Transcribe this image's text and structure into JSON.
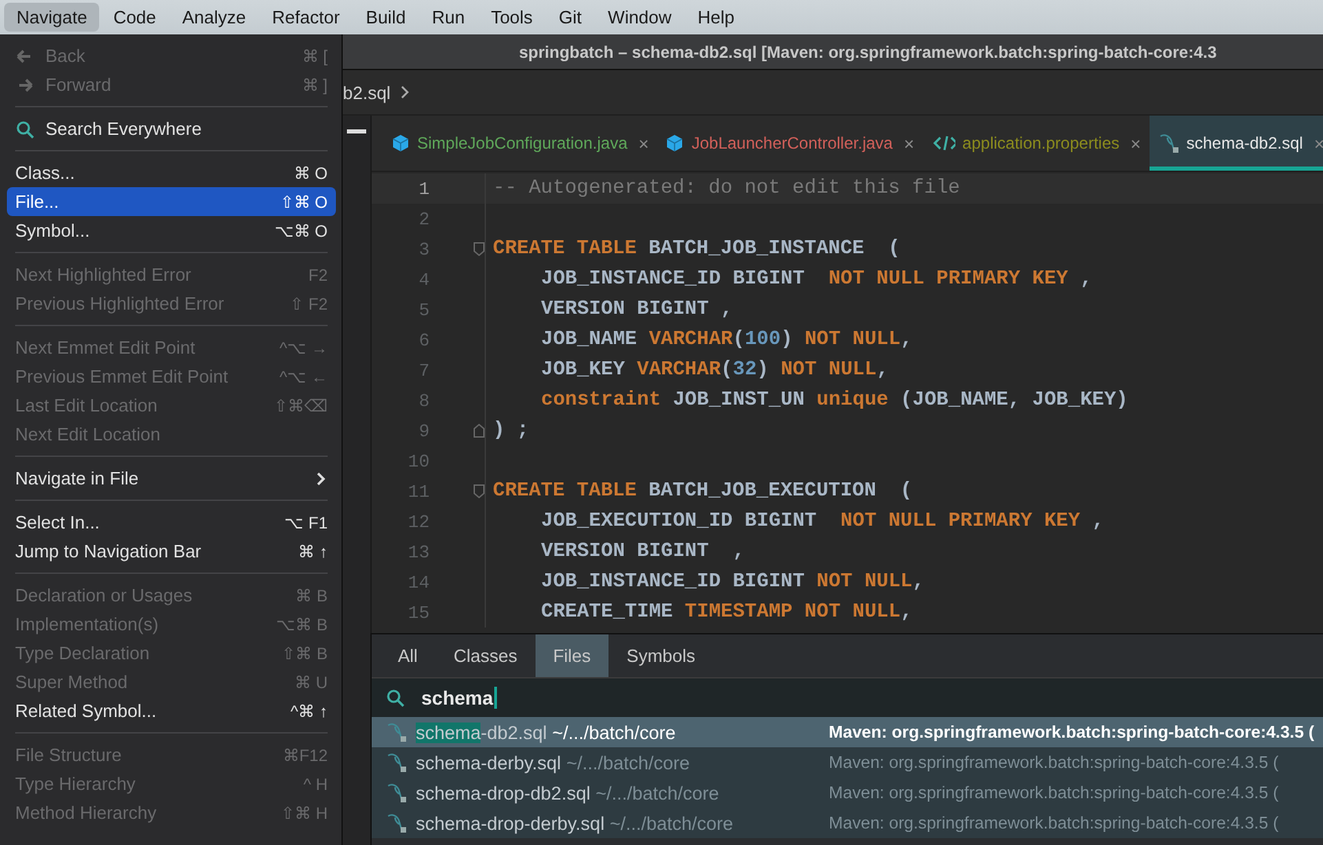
{
  "menubar": [
    {
      "label": "Navigate",
      "selected": true
    },
    {
      "label": "Code",
      "selected": false
    },
    {
      "label": "Analyze",
      "selected": false
    },
    {
      "label": "Refactor",
      "selected": false
    },
    {
      "label": "Build",
      "selected": false
    },
    {
      "label": "Run",
      "selected": false
    },
    {
      "label": "Tools",
      "selected": false
    },
    {
      "label": "Git",
      "selected": false
    },
    {
      "label": "Window",
      "selected": false
    },
    {
      "label": "Help",
      "selected": false
    }
  ],
  "menu": [
    {
      "kind": "back",
      "label": "Back",
      "shortcut": "⌘ [",
      "enabled": false,
      "selected": false
    },
    {
      "kind": "forward",
      "label": "Forward",
      "shortcut": "⌘ ]",
      "enabled": false,
      "selected": false
    },
    {
      "kind": "separator"
    },
    {
      "kind": "search",
      "label": "Search Everywhere",
      "enabled": true,
      "selected": false
    },
    {
      "kind": "separator"
    },
    {
      "kind": "action",
      "label": "Class...",
      "shortcut": "⌘ O",
      "enabled": true,
      "selected": false
    },
    {
      "kind": "action",
      "label": "File...",
      "shortcut": "⇧⌘ O",
      "enabled": true,
      "selected": true
    },
    {
      "kind": "action",
      "label": "Symbol...",
      "shortcut": "⌥⌘ O",
      "enabled": true,
      "selected": false
    },
    {
      "kind": "separator"
    },
    {
      "kind": "action",
      "label": "Next Highlighted Error",
      "shortcut": "F2",
      "enabled": false,
      "selected": false
    },
    {
      "kind": "action",
      "label": "Previous Highlighted Error",
      "shortcut": "⇧ F2",
      "enabled": false,
      "selected": false
    },
    {
      "kind": "separator"
    },
    {
      "kind": "action",
      "label": "Next Emmet Edit Point",
      "shortcut": "^⌥ →",
      "enabled": false,
      "selected": false
    },
    {
      "kind": "action",
      "label": "Previous Emmet Edit Point",
      "shortcut": "^⌥ ←",
      "enabled": false,
      "selected": false
    },
    {
      "kind": "action",
      "label": "Last Edit Location",
      "shortcut": "⇧⌘⌫",
      "enabled": false,
      "selected": false
    },
    {
      "kind": "action",
      "label": "Next Edit Location",
      "enabled": false,
      "selected": false
    },
    {
      "kind": "separator"
    },
    {
      "kind": "submenu",
      "label": "Navigate in File",
      "enabled": true,
      "selected": false
    },
    {
      "kind": "separator"
    },
    {
      "kind": "action",
      "label": "Select In...",
      "shortcut": "⌥ F1",
      "enabled": true,
      "selected": false
    },
    {
      "kind": "action",
      "label": "Jump to Navigation Bar",
      "shortcut": "⌘ ↑",
      "enabled": true,
      "selected": false
    },
    {
      "kind": "separator"
    },
    {
      "kind": "action",
      "label": "Declaration or Usages",
      "shortcut": "⌘ B",
      "enabled": false,
      "selected": false
    },
    {
      "kind": "action",
      "label": "Implementation(s)",
      "shortcut": "⌥⌘ B",
      "enabled": false,
      "selected": false
    },
    {
      "kind": "action",
      "label": "Type Declaration",
      "shortcut": "⇧⌘ B",
      "enabled": false,
      "selected": false
    },
    {
      "kind": "action",
      "label": "Super Method",
      "shortcut": "⌘ U",
      "enabled": false,
      "selected": false
    },
    {
      "kind": "action",
      "label": "Related Symbol...",
      "shortcut": "^⌘ ↑",
      "enabled": true,
      "selected": false
    },
    {
      "kind": "separator"
    },
    {
      "kind": "action",
      "label": "File Structure",
      "shortcut": "⌘F12",
      "enabled": false,
      "selected": false
    },
    {
      "kind": "action",
      "label": "Type Hierarchy",
      "shortcut": "^ H",
      "enabled": false,
      "selected": false
    },
    {
      "kind": "action",
      "label": "Method Hierarchy",
      "shortcut": "⇧⌘ H",
      "enabled": false,
      "selected": false
    }
  ],
  "window": {
    "title": "springbatch – schema-db2.sql [Maven: org.springframework.batch:spring-batch-core:4.3"
  },
  "breadcrumb": {
    "label": "b2.sql"
  },
  "tabs": [
    {
      "kind": "java",
      "label": "SimpleJobConfiguration.java",
      "color": "#5fa85a",
      "close": "×",
      "selected": false
    },
    {
      "kind": "java",
      "label": "JobLauncherController.java",
      "color": "#d2605a",
      "close": "×",
      "selected": false
    },
    {
      "kind": "properties",
      "label": "application.properties",
      "color": "#8c8c1e",
      "close": "×",
      "selected": false
    },
    {
      "kind": "sql",
      "label": "schema-db2.sql",
      "color": "#e6e6e6",
      "close": "×",
      "selected": true
    }
  ],
  "code": [
    {
      "number": "1",
      "current": true,
      "indent": false,
      "fold_start": false,
      "fold_end": false,
      "tokens": [
        {
          "kind": "comment",
          "text": "-- Autogenerated: do not edit this file"
        }
      ]
    },
    {
      "number": "2",
      "current": false,
      "fold_start": false,
      "fold_end": false
    },
    {
      "number": "3",
      "current": false,
      "indent": false,
      "fold_start": true,
      "fold_end": false,
      "tokens": [
        {
          "kind": "keyword",
          "text": "CREATE TABLE"
        },
        {
          "kind": "plain",
          "text": " BATCH_JOB_INSTANCE  ("
        }
      ]
    },
    {
      "number": "4",
      "current": false,
      "indent": true,
      "fold_start": false,
      "fold_end": false,
      "tokens": [
        {
          "kind": "plain",
          "text": "JOB_INSTANCE_ID BIGINT  "
        },
        {
          "kind": "keyword",
          "text": "NOT NULL PRIMARY KEY"
        },
        {
          "kind": "plain",
          "text": " ,"
        }
      ]
    },
    {
      "number": "5",
      "current": false,
      "indent": true,
      "fold_start": false,
      "fold_end": false,
      "tokens": [
        {
          "kind": "plain",
          "text": "VERSION BIGINT ,"
        }
      ]
    },
    {
      "number": "6",
      "current": false,
      "indent": true,
      "fold_start": false,
      "fold_end": false,
      "tokens": [
        {
          "kind": "plain",
          "text": "JOB_NAME "
        },
        {
          "kind": "keyword",
          "text": "VARCHAR"
        },
        {
          "kind": "plain",
          "text": "("
        },
        {
          "kind": "number",
          "text": "100"
        },
        {
          "kind": "plain",
          "text": ") "
        },
        {
          "kind": "keyword",
          "text": "NOT NULL"
        },
        {
          "kind": "plain",
          "text": ","
        }
      ]
    },
    {
      "number": "7",
      "current": false,
      "indent": true,
      "fold_start": false,
      "fold_end": false,
      "tokens": [
        {
          "kind": "plain",
          "text": "JOB_KEY "
        },
        {
          "kind": "keyword",
          "text": "VARCHAR"
        },
        {
          "kind": "plain",
          "text": "("
        },
        {
          "kind": "number",
          "text": "32"
        },
        {
          "kind": "plain",
          "text": ") "
        },
        {
          "kind": "keyword",
          "text": "NOT NULL"
        },
        {
          "kind": "plain",
          "text": ","
        }
      ]
    },
    {
      "number": "8",
      "current": false,
      "indent": true,
      "fold_start": false,
      "fold_end": false,
      "tokens": [
        {
          "kind": "keyword",
          "text": "constraint"
        },
        {
          "kind": "plain",
          "text": " JOB_INST_UN "
        },
        {
          "kind": "keyword",
          "text": "unique"
        },
        {
          "kind": "plain",
          "text": " (JOB_NAME, JOB_KEY)"
        }
      ]
    },
    {
      "number": "9",
      "current": false,
      "indent": false,
      "fold_start": false,
      "fold_end": true,
      "tokens": [
        {
          "kind": "plain",
          "text": ") ;"
        }
      ]
    },
    {
      "number": "10",
      "current": false,
      "fold_start": false,
      "fold_end": false
    },
    {
      "number": "11",
      "current": false,
      "indent": false,
      "fold_start": true,
      "fold_end": false,
      "tokens": [
        {
          "kind": "keyword",
          "text": "CREATE TABLE"
        },
        {
          "kind": "plain",
          "text": " BATCH_JOB_EXECUTION  ("
        }
      ]
    },
    {
      "number": "12",
      "current": false,
      "indent": true,
      "fold_start": false,
      "fold_end": false,
      "tokens": [
        {
          "kind": "plain",
          "text": "JOB_EXECUTION_ID BIGINT  "
        },
        {
          "kind": "keyword",
          "text": "NOT NULL PRIMARY KEY"
        },
        {
          "kind": "plain",
          "text": " ,"
        }
      ]
    },
    {
      "number": "13",
      "current": false,
      "indent": true,
      "fold_start": false,
      "fold_end": false,
      "tokens": [
        {
          "kind": "plain",
          "text": "VERSION BIGINT  ,"
        }
      ]
    },
    {
      "number": "14",
      "current": false,
      "indent": true,
      "fold_start": false,
      "fold_end": false,
      "tokens": [
        {
          "kind": "plain",
          "text": "JOB_INSTANCE_ID BIGINT "
        },
        {
          "kind": "keyword",
          "text": "NOT NULL"
        },
        {
          "kind": "plain",
          "text": ","
        }
      ]
    },
    {
      "number": "15",
      "current": false,
      "indent": true,
      "fold_start": false,
      "fold_end": false,
      "tokens": [
        {
          "kind": "plain",
          "text": "CREATE_TIME "
        },
        {
          "kind": "keyword",
          "text": "TIMESTAMP NOT NULL"
        },
        {
          "kind": "plain",
          "text": ","
        }
      ]
    }
  ],
  "popup": {
    "tabs": [
      {
        "label": "All",
        "selected": false
      },
      {
        "label": "Classes",
        "selected": false
      },
      {
        "label": "Files",
        "selected": true
      },
      {
        "label": "Symbols",
        "selected": false
      }
    ],
    "search": {
      "value": "schema"
    },
    "results": [
      {
        "match": "schema",
        "rest": "-db2.sql",
        "path": "~/.../batch/core",
        "location": "Maven: org.springframework.batch:spring-batch-core:4.3.5 (",
        "selected": true
      },
      {
        "match": "schema",
        "rest": "-derby.sql",
        "path": "~/.../batch/core",
        "location": "Maven: org.springframework.batch:spring-batch-core:4.3.5 (",
        "selected": false
      },
      {
        "match": "schema",
        "rest": "-drop-db2.sql",
        "path": "~/.../batch/core",
        "location": "Maven: org.springframework.batch:spring-batch-core:4.3.5 (",
        "selected": false
      },
      {
        "match": "schema",
        "rest": "-drop-derby.sql",
        "path": "~/.../batch/core",
        "location": "Maven: org.springframework.batch:spring-batch-core:4.3.5 (",
        "selected": false
      }
    ]
  }
}
